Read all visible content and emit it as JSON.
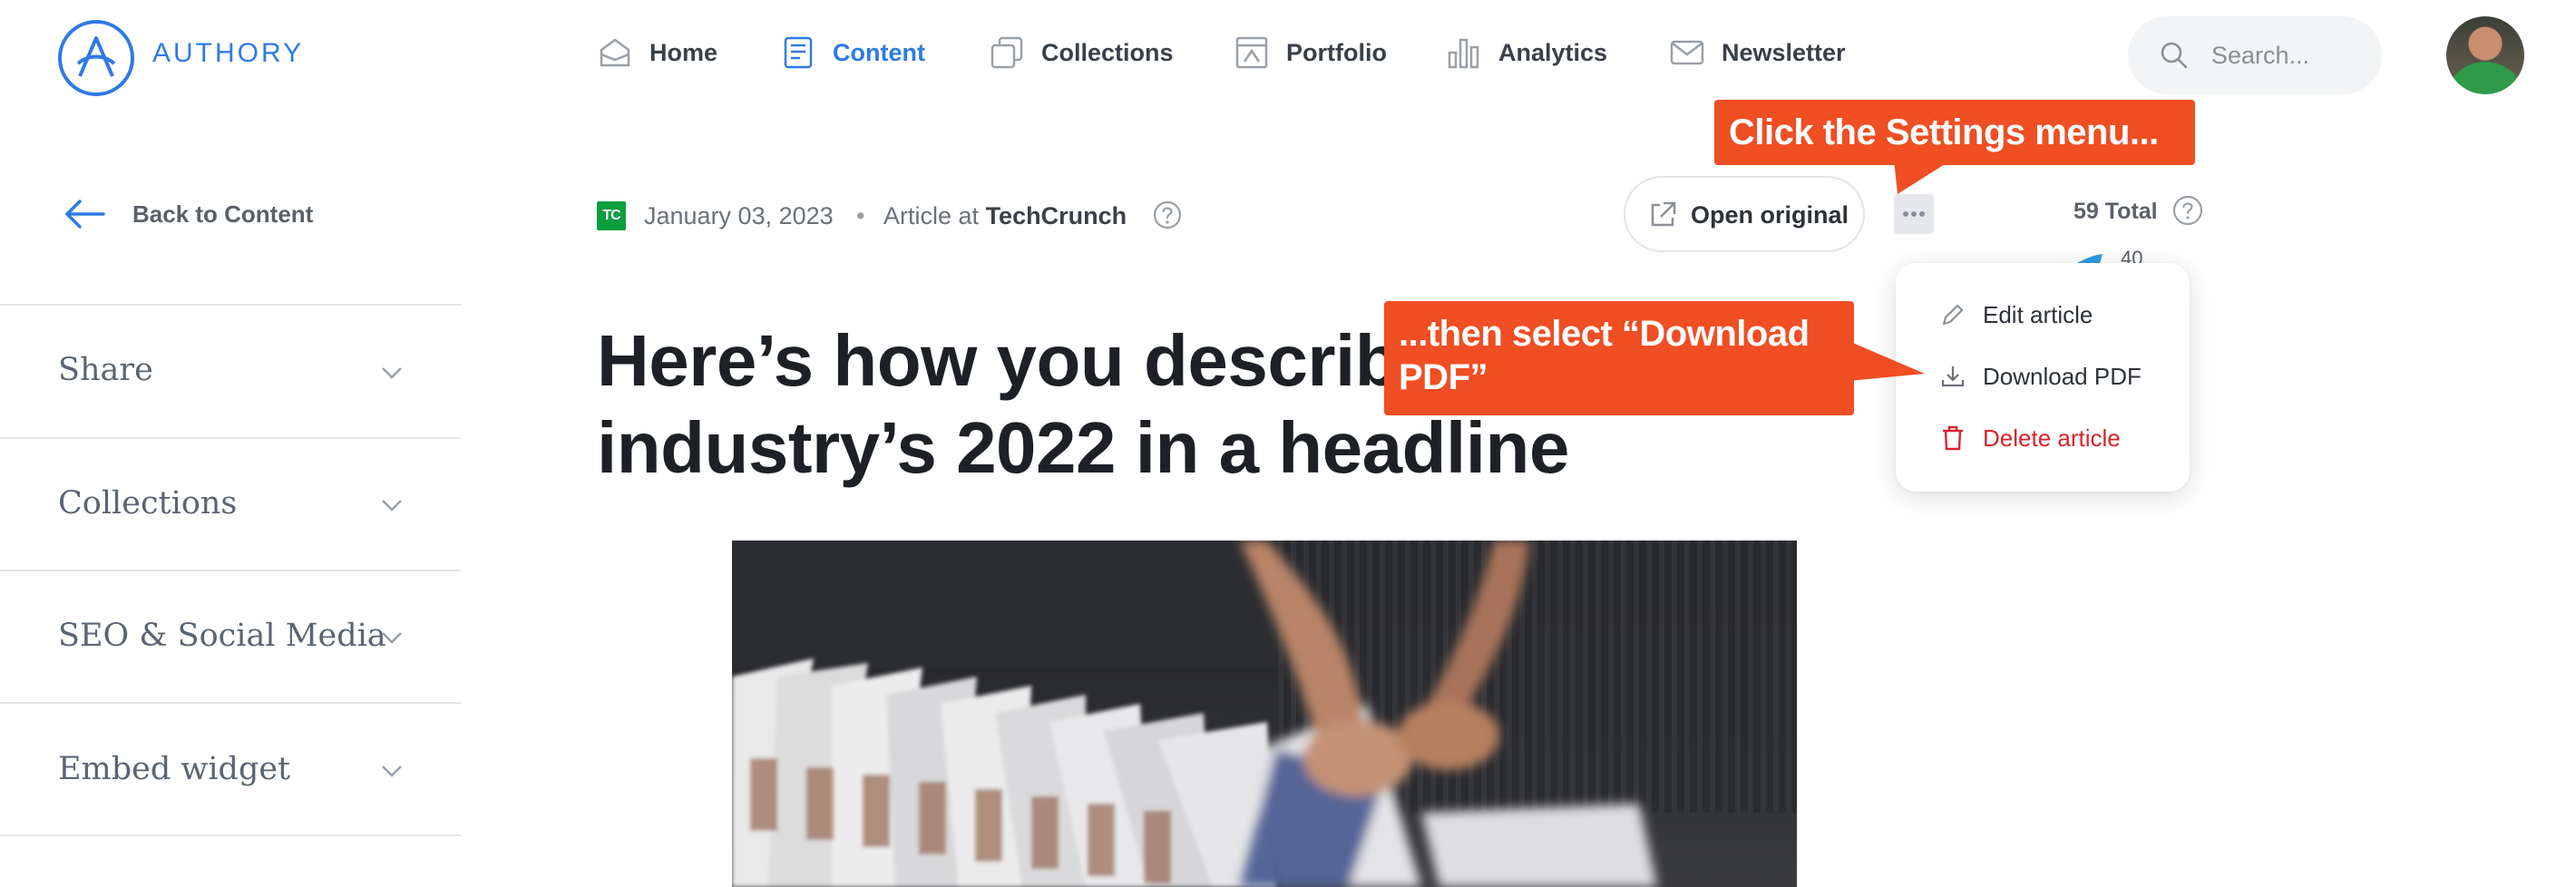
{
  "brand": {
    "name": "AUTHORY",
    "color": "#2f7ae5"
  },
  "nav": {
    "items": [
      {
        "label": "Home",
        "icon": "home-icon"
      },
      {
        "label": "Content",
        "icon": "document-icon",
        "active": true
      },
      {
        "label": "Collections",
        "icon": "collections-icon"
      },
      {
        "label": "Portfolio",
        "icon": "portfolio-icon"
      },
      {
        "label": "Analytics",
        "icon": "bar-chart-icon"
      },
      {
        "label": "Newsletter",
        "icon": "envelope-icon"
      }
    ],
    "search_placeholder": "Search..."
  },
  "sidebar": {
    "back_label": "Back to Content",
    "sections": [
      {
        "label": "Share"
      },
      {
        "label": "Collections"
      },
      {
        "label": "SEO & Social Media"
      },
      {
        "label": "Embed widget"
      }
    ]
  },
  "article": {
    "date": "January 03, 2023",
    "separator": "•",
    "type_prefix": "Article at",
    "publication": "TechCrunch",
    "source_badge": "TC",
    "headline": "Here’s how you describ",
    "headline_line2": "industry’s 2022 in a headline",
    "open_original_label": "Open original"
  },
  "stats": {
    "total_label": "59 Total",
    "twitter_count_partial": "40"
  },
  "settings_menu": {
    "items": [
      {
        "label": "Edit article",
        "icon": "pencil-icon"
      },
      {
        "label": "Download PDF",
        "icon": "download-icon"
      },
      {
        "label": "Delete article",
        "icon": "trash-icon",
        "danger": true
      }
    ]
  },
  "callouts": {
    "step1": "Click the Settings menu...",
    "step2": "...then select “Download PDF”"
  },
  "colors": {
    "accent": "#2f7ae5",
    "callout": "#f04e23",
    "danger": "#d9242b",
    "techcrunch": "#0a9e3e"
  }
}
